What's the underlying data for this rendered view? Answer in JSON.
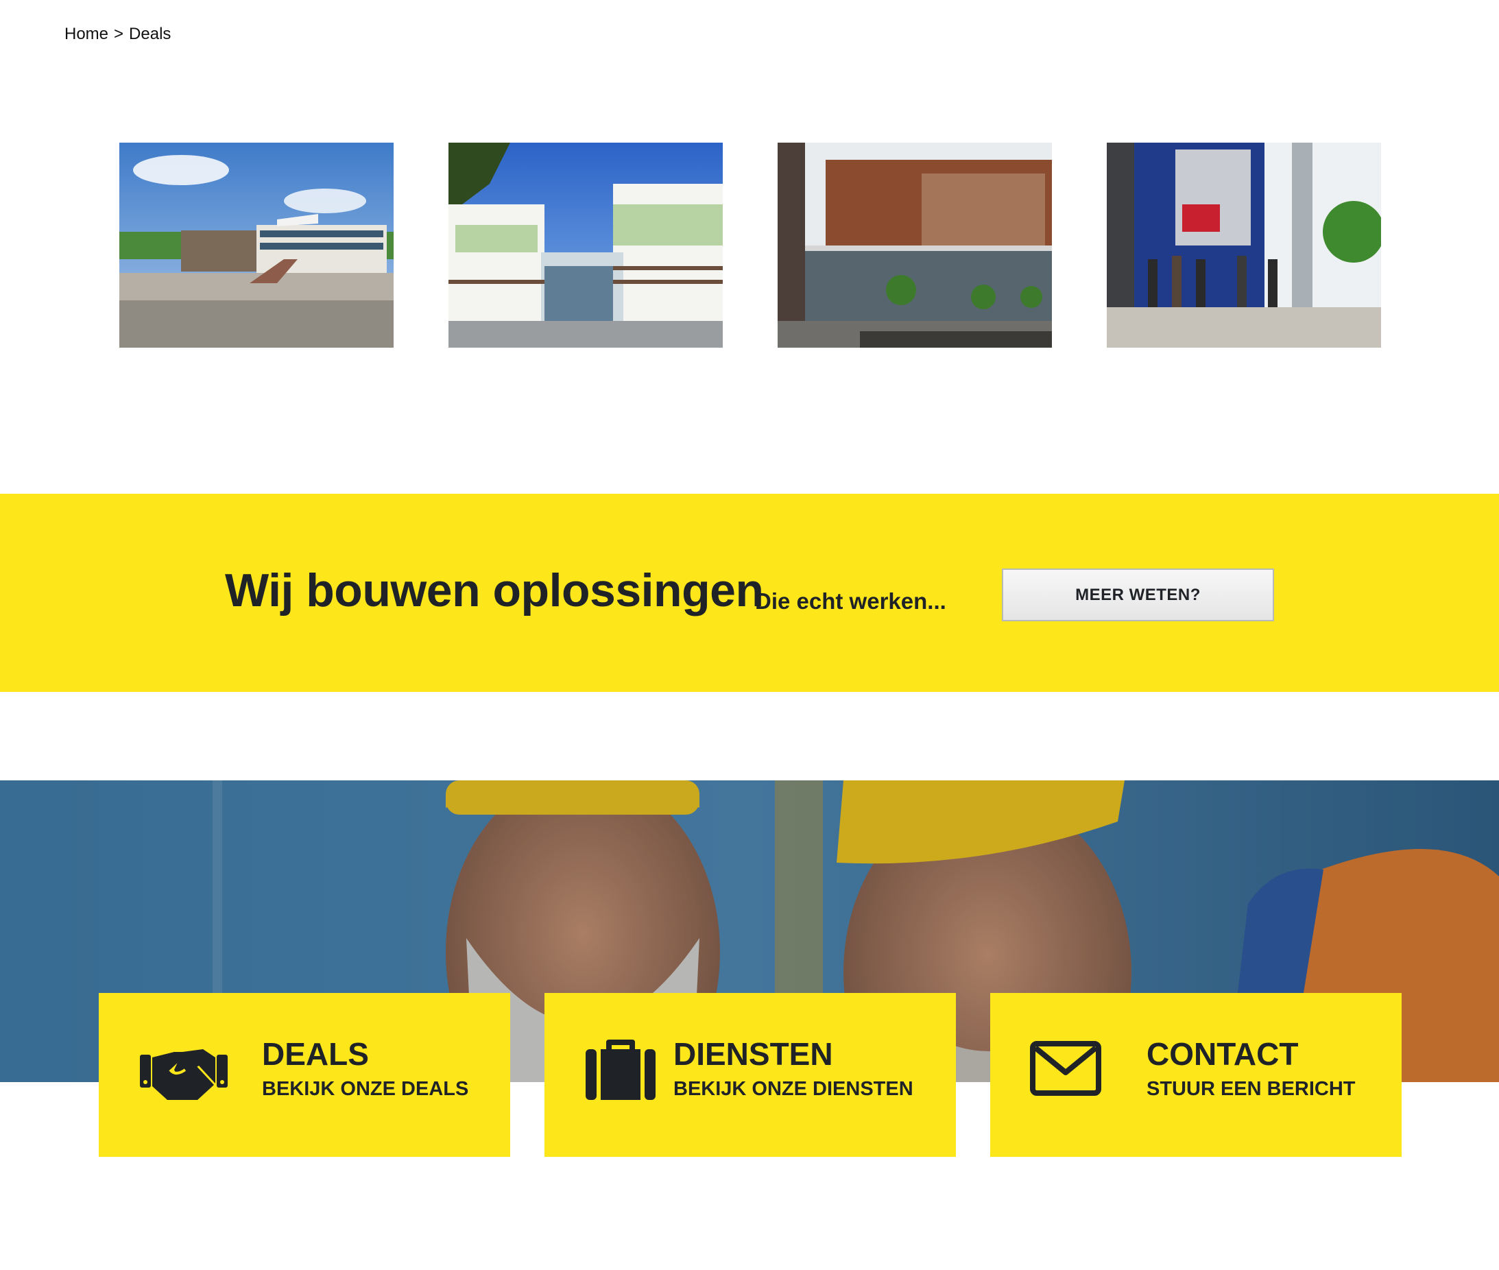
{
  "breadcrumb": {
    "home": "Home",
    "separator": ">",
    "current": "Deals"
  },
  "gallery": {
    "photos": [
      {
        "name": "building-photo-1"
      },
      {
        "name": "building-photo-2"
      },
      {
        "name": "building-photo-3"
      },
      {
        "name": "building-photo-4"
      }
    ]
  },
  "cta": {
    "title": "Wij bouwen oplossingen",
    "subtitle": "Die echt werken...",
    "button_label": "MEER WETEN?",
    "background_color": "#fde71b"
  },
  "cards": [
    {
      "icon": "handshake-icon",
      "title": "DEALS",
      "subtitle": "BEKIJK ONZE DEALS"
    },
    {
      "icon": "briefcase-icon",
      "title": "DIENSTEN",
      "subtitle": "BEKIJK ONZE DIENSTEN"
    },
    {
      "icon": "envelope-icon",
      "title": "CONTACT",
      "subtitle": "STUUR EEN BERICHT"
    }
  ],
  "colors": {
    "accent_yellow": "#fde71b",
    "text_dark": "#1f2328"
  }
}
